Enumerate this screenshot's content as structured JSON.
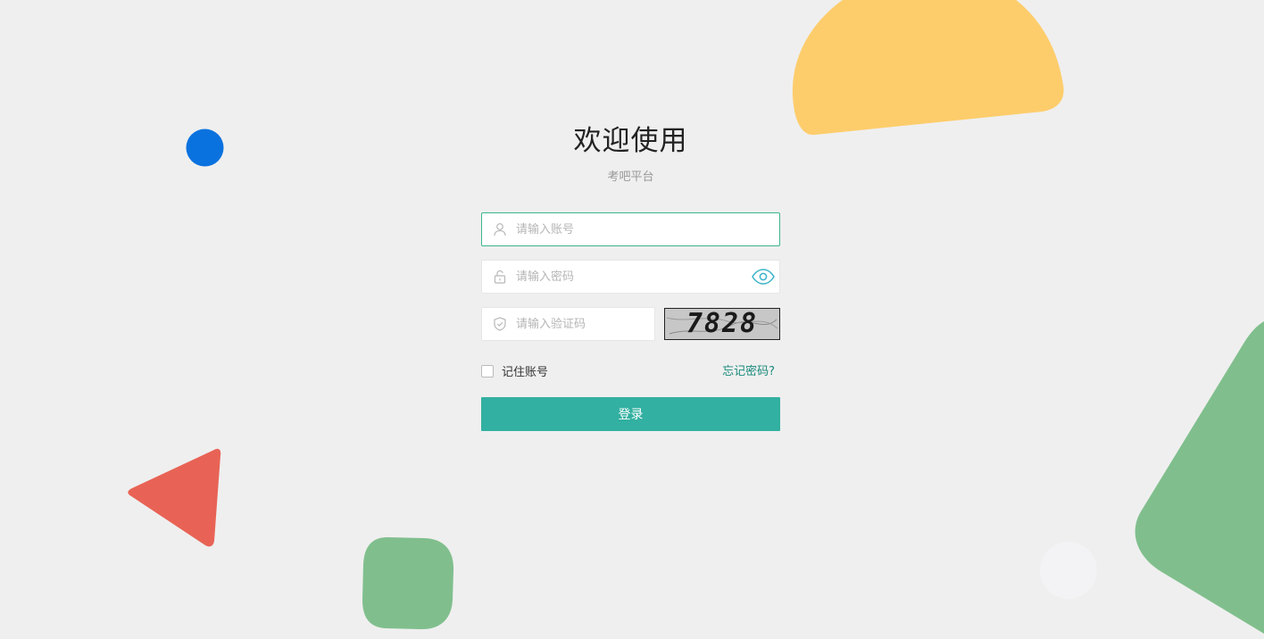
{
  "header": {
    "title": "欢迎使用",
    "subtitle": "考吧平台"
  },
  "form": {
    "account_placeholder": "请输入账号",
    "password_placeholder": "请输入密码",
    "captcha_placeholder": "请输入验证码",
    "captcha_code": "7828",
    "remember_label": "记住账号",
    "forgot_label": "忘记密码?",
    "login_label": "登录"
  },
  "icons": {
    "account": "user-icon",
    "password": "lock-icon",
    "captcha": "shield-check-icon",
    "toggle_password": "eye-icon"
  },
  "colors": {
    "accent": "#32b0a1",
    "focus_border": "#3cb58f",
    "link": "#1a8a7b",
    "background": "#efefef",
    "deco_yellow": "#fdcd6c",
    "deco_blue": "#0a72df",
    "deco_red": "#e86355",
    "deco_green": "#80bf8d"
  }
}
